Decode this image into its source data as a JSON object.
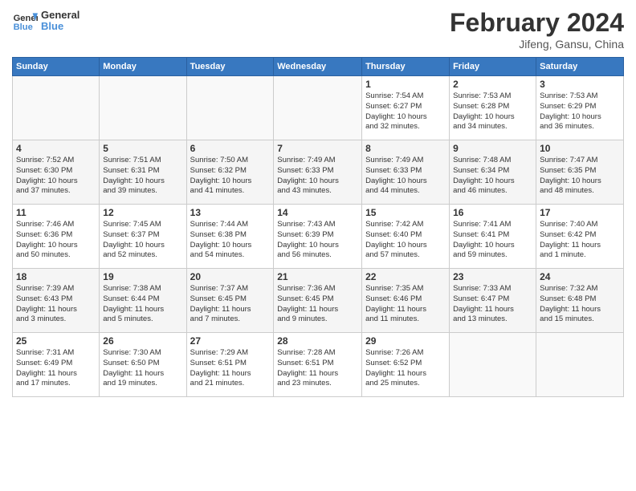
{
  "header": {
    "logo_general": "General",
    "logo_blue": "Blue",
    "month_year": "February 2024",
    "location": "Jifeng, Gansu, China"
  },
  "days_of_week": [
    "Sunday",
    "Monday",
    "Tuesday",
    "Wednesday",
    "Thursday",
    "Friday",
    "Saturday"
  ],
  "weeks": [
    [
      {
        "day": "",
        "info": ""
      },
      {
        "day": "",
        "info": ""
      },
      {
        "day": "",
        "info": ""
      },
      {
        "day": "",
        "info": ""
      },
      {
        "day": "1",
        "info": "Sunrise: 7:54 AM\nSunset: 6:27 PM\nDaylight: 10 hours\nand 32 minutes."
      },
      {
        "day": "2",
        "info": "Sunrise: 7:53 AM\nSunset: 6:28 PM\nDaylight: 10 hours\nand 34 minutes."
      },
      {
        "day": "3",
        "info": "Sunrise: 7:53 AM\nSunset: 6:29 PM\nDaylight: 10 hours\nand 36 minutes."
      }
    ],
    [
      {
        "day": "4",
        "info": "Sunrise: 7:52 AM\nSunset: 6:30 PM\nDaylight: 10 hours\nand 37 minutes."
      },
      {
        "day": "5",
        "info": "Sunrise: 7:51 AM\nSunset: 6:31 PM\nDaylight: 10 hours\nand 39 minutes."
      },
      {
        "day": "6",
        "info": "Sunrise: 7:50 AM\nSunset: 6:32 PM\nDaylight: 10 hours\nand 41 minutes."
      },
      {
        "day": "7",
        "info": "Sunrise: 7:49 AM\nSunset: 6:33 PM\nDaylight: 10 hours\nand 43 minutes."
      },
      {
        "day": "8",
        "info": "Sunrise: 7:49 AM\nSunset: 6:33 PM\nDaylight: 10 hours\nand 44 minutes."
      },
      {
        "day": "9",
        "info": "Sunrise: 7:48 AM\nSunset: 6:34 PM\nDaylight: 10 hours\nand 46 minutes."
      },
      {
        "day": "10",
        "info": "Sunrise: 7:47 AM\nSunset: 6:35 PM\nDaylight: 10 hours\nand 48 minutes."
      }
    ],
    [
      {
        "day": "11",
        "info": "Sunrise: 7:46 AM\nSunset: 6:36 PM\nDaylight: 10 hours\nand 50 minutes."
      },
      {
        "day": "12",
        "info": "Sunrise: 7:45 AM\nSunset: 6:37 PM\nDaylight: 10 hours\nand 52 minutes."
      },
      {
        "day": "13",
        "info": "Sunrise: 7:44 AM\nSunset: 6:38 PM\nDaylight: 10 hours\nand 54 minutes."
      },
      {
        "day": "14",
        "info": "Sunrise: 7:43 AM\nSunset: 6:39 PM\nDaylight: 10 hours\nand 56 minutes."
      },
      {
        "day": "15",
        "info": "Sunrise: 7:42 AM\nSunset: 6:40 PM\nDaylight: 10 hours\nand 57 minutes."
      },
      {
        "day": "16",
        "info": "Sunrise: 7:41 AM\nSunset: 6:41 PM\nDaylight: 10 hours\nand 59 minutes."
      },
      {
        "day": "17",
        "info": "Sunrise: 7:40 AM\nSunset: 6:42 PM\nDaylight: 11 hours\nand 1 minute."
      }
    ],
    [
      {
        "day": "18",
        "info": "Sunrise: 7:39 AM\nSunset: 6:43 PM\nDaylight: 11 hours\nand 3 minutes."
      },
      {
        "day": "19",
        "info": "Sunrise: 7:38 AM\nSunset: 6:44 PM\nDaylight: 11 hours\nand 5 minutes."
      },
      {
        "day": "20",
        "info": "Sunrise: 7:37 AM\nSunset: 6:45 PM\nDaylight: 11 hours\nand 7 minutes."
      },
      {
        "day": "21",
        "info": "Sunrise: 7:36 AM\nSunset: 6:45 PM\nDaylight: 11 hours\nand 9 minutes."
      },
      {
        "day": "22",
        "info": "Sunrise: 7:35 AM\nSunset: 6:46 PM\nDaylight: 11 hours\nand 11 minutes."
      },
      {
        "day": "23",
        "info": "Sunrise: 7:33 AM\nSunset: 6:47 PM\nDaylight: 11 hours\nand 13 minutes."
      },
      {
        "day": "24",
        "info": "Sunrise: 7:32 AM\nSunset: 6:48 PM\nDaylight: 11 hours\nand 15 minutes."
      }
    ],
    [
      {
        "day": "25",
        "info": "Sunrise: 7:31 AM\nSunset: 6:49 PM\nDaylight: 11 hours\nand 17 minutes."
      },
      {
        "day": "26",
        "info": "Sunrise: 7:30 AM\nSunset: 6:50 PM\nDaylight: 11 hours\nand 19 minutes."
      },
      {
        "day": "27",
        "info": "Sunrise: 7:29 AM\nSunset: 6:51 PM\nDaylight: 11 hours\nand 21 minutes."
      },
      {
        "day": "28",
        "info": "Sunrise: 7:28 AM\nSunset: 6:51 PM\nDaylight: 11 hours\nand 23 minutes."
      },
      {
        "day": "29",
        "info": "Sunrise: 7:26 AM\nSunset: 6:52 PM\nDaylight: 11 hours\nand 25 minutes."
      },
      {
        "day": "",
        "info": ""
      },
      {
        "day": "",
        "info": ""
      }
    ]
  ]
}
